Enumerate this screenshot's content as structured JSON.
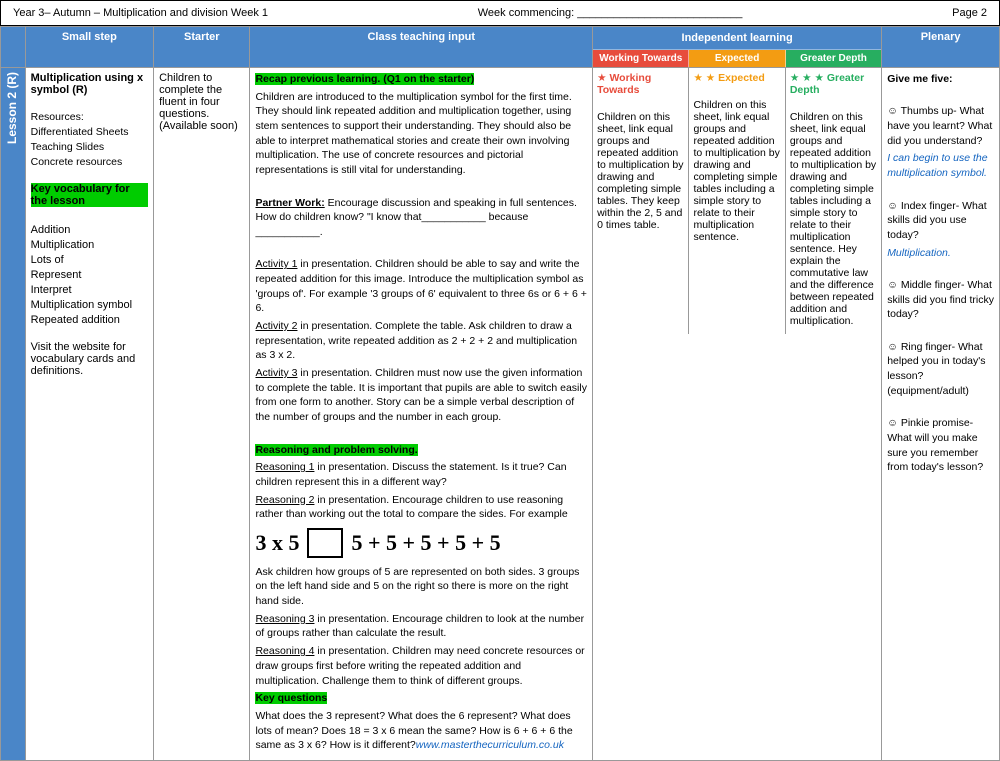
{
  "header": {
    "title": "Year 3– Autumn – Multiplication and division Week 1",
    "week_commencing": "Week commencing: ___________________________",
    "page": "Page 2"
  },
  "columns": {
    "small_step": "Small step",
    "starter": "Starter",
    "class_teaching": "Class teaching input",
    "independent": "Independent learning",
    "plenary": "Plenary"
  },
  "lesson": {
    "sidebar_label": "Lesson 2 (R)",
    "small_step_title": "Multiplication using x symbol (R)",
    "resources_label": "Resources:",
    "resources_items": [
      "Differentiated Sheets",
      "Teaching Slides",
      "Concrete resources"
    ],
    "key_vocab_label": "Key vocabulary for the lesson",
    "vocab_items": [
      "Addition",
      "Multiplication",
      "Lots of",
      "Represent",
      "Interpret",
      "Multiplication symbol",
      "Repeated addition"
    ],
    "visit_text": "Visit the website for vocabulary cards and definitions."
  },
  "starter": {
    "text": "Children to complete the fluent in four questions. (Available soon)"
  },
  "class_teaching": {
    "recap_label": "Recap previous learning. (Q1 on the starter)",
    "intro_para": "Children are introduced to the multiplication symbol for the first time. They should link repeated addition and multiplication together, using stem sentences to support their understanding. They should also be able to interpret mathematical stories and create their own involving multiplication. The use of concrete resources and pictorial representations is still vital for understanding.",
    "partner_work": "Partner Work:",
    "partner_text": "Encourage discussion and speaking in full sentences. How do children know? \"I know that___________ because ___________.",
    "activity1": "Activity 1",
    "activity1_text": "in presentation. Children should be able to say and write the repeated addition for this image. Introduce the multiplication symbol as 'groups of'. For example '3 groups of 6' equivalent to three 6s or 6 + 6 + 6.",
    "activity2": "Activity 2",
    "activity2_text": "in presentation. Complete the table. Ask children to draw a representation, write repeated addition as 2 + 2 + 2 and multiplication as 3 x 2.",
    "activity3": "Activity 3",
    "activity3_text": "in presentation. Children must now use the given information to complete the table. It is important that pupils are able to switch easily from one form to another. Story can be a simple verbal description of the number of groups and the number in each group.",
    "reasoning_label": "Reasoning and problem solving.",
    "reasoning1": "Reasoning 1",
    "reasoning1_text": "in presentation. Discuss the statement. Is it true? Can children represent this in a different way?",
    "reasoning2": "Reasoning 2",
    "reasoning2_text": "in presentation. Encourage children to use reasoning rather than working out the total to compare the sides. For example",
    "math_left": "3 x 5",
    "math_right": "5 + 5 + 5 + 5 + 5",
    "math_note": "Ask children how groups of 5 are represented on both sides. 3 groups on the left hand side and 5 on the right so there is more on the right hand side.",
    "reasoning3": "Reasoning 3",
    "reasoning3_text": "in presentation. Encourage children to look at the number of groups rather than calculate the result.",
    "reasoning4": "Reasoning 4",
    "reasoning4_text": "in presentation. Children may need concrete resources or draw groups first before writing the repeated addition and multiplication. Challenge them to think of different groups.",
    "key_questions": "Key questions",
    "key_questions_text": "What does the 3 represent? What does the 6 represent? What does lots of mean? Does 18 = 3 x 6 mean the same? How is 6 + 6 + 6 the same as 3 x 6? How is it different?",
    "url": "www.masterthecurriculum.co.uk"
  },
  "independent": {
    "working_towards_label": "Working Towards",
    "expected_label": "Expected",
    "greater_depth_label": "Greater Depth",
    "working_towards_star": "★",
    "expected_stars": "★ ★",
    "greater_depth_stars": "★ ★ ★",
    "wt_text": "Working Towards",
    "wt_body": "Children on this sheet, link equal groups and repeated addition to multiplication by drawing and completing simple tables. They keep within the 2, 5 and 0 times table.",
    "exp_text": "Expected",
    "exp_body": "Children on this sheet, link equal groups and repeated addition to multiplication by drawing and completing simple tables including a simple story to relate to their multiplication sentence.",
    "gd_text": "Greater Depth",
    "gd_body": "Children on this sheet, link equal groups and repeated addition to multiplication by drawing and completing simple tables including a simple story to relate to their multiplication sentence. Hey explain the commutative law and the difference between repeated addition and multiplication."
  },
  "plenary": {
    "title": "Give me five:",
    "thumbs": "☺ Thumbs up- What have you learnt? What did you understand?",
    "blue_text": "I can begin to use the multiplication symbol.",
    "index": "☺ Index finger- What skills did you use today?",
    "index_blue": "Multiplication.",
    "middle": "☺ Middle finger- What skills did you find tricky today?",
    "ring": "☺ Ring finger- What helped you in today's lesson? (equipment/adult)",
    "pinkie": "☺ Pinkie promise- What will you make sure you remember from today's lesson?"
  }
}
